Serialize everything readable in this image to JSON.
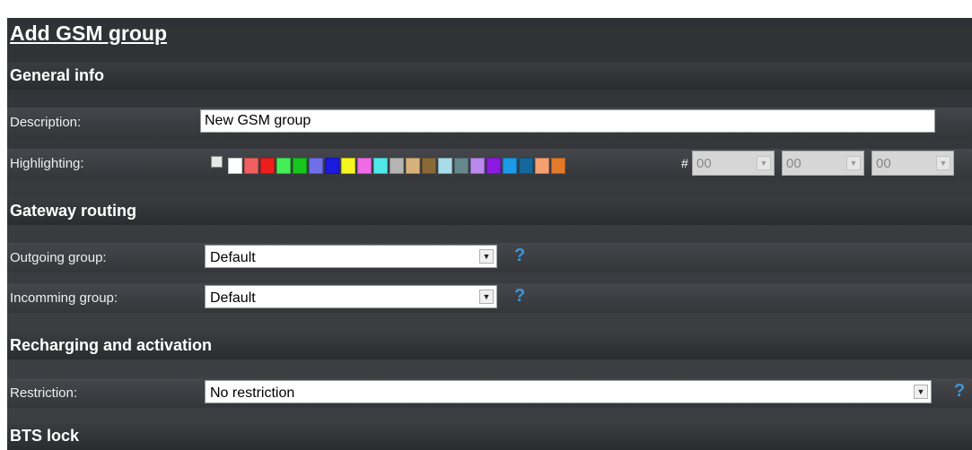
{
  "page": {
    "title": "Add GSM group"
  },
  "sections": {
    "general": "General info",
    "gateway": "Gateway routing",
    "recharging": "Recharging and activation",
    "bts": "BTS lock"
  },
  "fields": {
    "description": {
      "label": "Description:",
      "value": "New GSM group"
    },
    "highlighting": {
      "label": "Highlighting:",
      "checked": false,
      "hash": "#",
      "hex": [
        "00",
        "00",
        "00"
      ],
      "colors": [
        "#ffffff",
        "#f06060",
        "#ee1c1c",
        "#44ee55",
        "#16c61c",
        "#6f6fe8",
        "#1a1ae0",
        "#f5f520",
        "#f06ae8",
        "#50e8e8",
        "#b4b4b4",
        "#d6b27a",
        "#8a6a34",
        "#a8dce6",
        "#66888c",
        "#bb88ee",
        "#8c1ae0",
        "#1a9ae8",
        "#14689c",
        "#f5a070",
        "#e27a2a"
      ]
    },
    "outgoing_group": {
      "label": "Outgoing group:",
      "value": "Default",
      "help": "?"
    },
    "incoming_group": {
      "label": "Incomming group:",
      "value": "Default",
      "help": "?"
    },
    "restriction": {
      "label": "Restriction:",
      "value": "No restriction",
      "help": "?"
    }
  },
  "icons": {
    "dropdown": "chevron-down-icon",
    "help": "help-icon"
  }
}
